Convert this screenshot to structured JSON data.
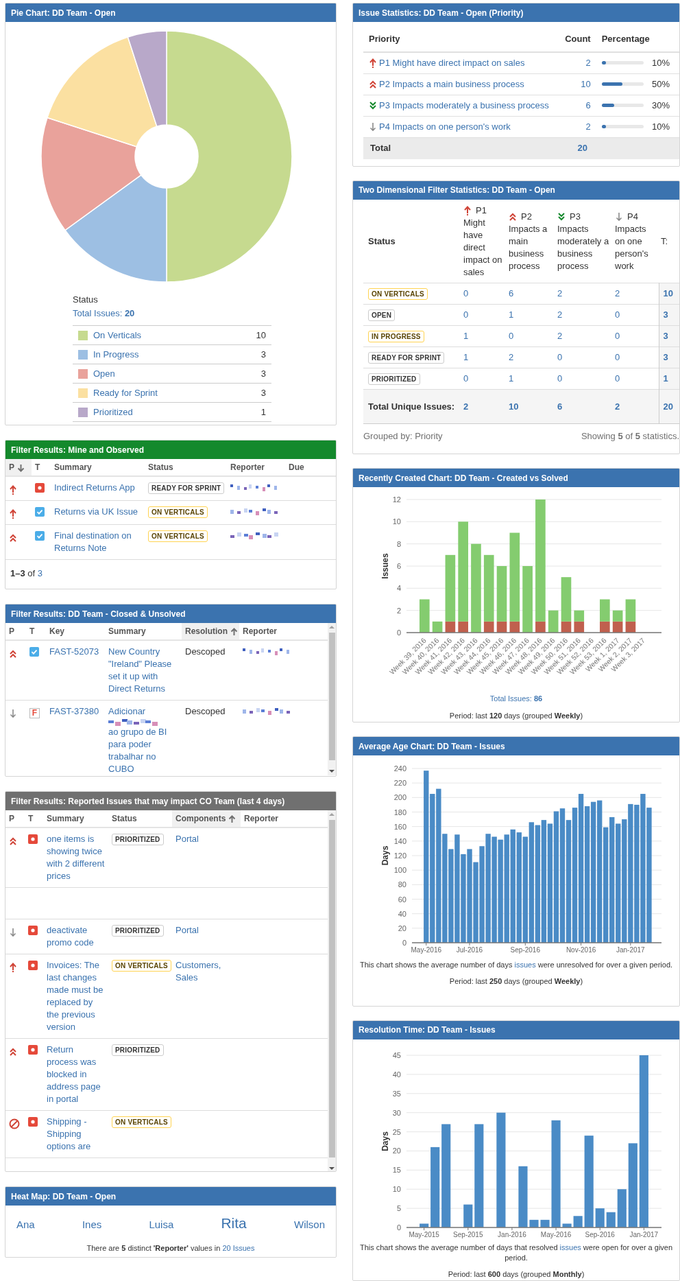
{
  "left_column": [
    {
      "kind": "pie",
      "color": "#3b73af",
      "title": "Pie Chart: DD Team - Open",
      "chart_data": {
        "type": "donut",
        "categories": [
          "On Verticals",
          "In Progress",
          "Open",
          "Ready for Sprint",
          "Prioritized"
        ],
        "values": [
          50,
          15,
          15,
          15,
          5
        ]
      },
      "status_label": "Status",
      "total_label": "Total Issues:",
      "total": "20",
      "legend": [
        {
          "count": "10",
          "color": "#c6da8f"
        },
        {
          "count": "3",
          "color": "#9dbfe3"
        },
        {
          "count": "3",
          "color": "#e9a29b"
        },
        {
          "count": "3",
          "color": "#fbe0a1"
        },
        {
          "count": "1",
          "color": "#b8a8c9"
        }
      ]
    },
    {
      "kind": "filter",
      "color": "#14892c",
      "title": "Filter Results: Mine and Observed",
      "columns": [
        {
          "label": "P",
          "kind": "priority",
          "sorted": true,
          "ascending": false
        },
        {
          "label": "T",
          "kind": "type",
          "sorted": false
        },
        {
          "label": "Summary",
          "kind": "summary",
          "sorted": false
        },
        {
          "label": "Status",
          "kind": "status",
          "sorted": false
        },
        {
          "label": "Reporter",
          "kind": "reporter",
          "sorted": false
        },
        {
          "label": "Due",
          "kind": "due",
          "sorted": false
        }
      ],
      "rows": [
        {
          "priority": {
            "kind": "highest"
          },
          "type": {
            "kind": "bug"
          },
          "summary": "Indirect Returns App",
          "status": {
            "text": "READY FOR SPRINT",
            "kind": "todo"
          },
          "reporter_hidden": true
        },
        {
          "priority": {
            "kind": "highest"
          },
          "type": {
            "kind": "task"
          },
          "summary": "Returns via UK Issue",
          "status": {
            "text": "ON VERTICALS",
            "kind": "inprogress"
          },
          "reporter_hidden": true
        },
        {
          "priority": {
            "kind": "high"
          },
          "type": {
            "kind": "task"
          },
          "summary": "Final destination on Returns Note",
          "status": {
            "text": "ON VERTICALS",
            "kind": "inprogress"
          },
          "reporter_hidden": true
        }
      ],
      "pagination": "**1–3** of",
      "pagination_link": "3"
    },
    {
      "kind": "filter",
      "color": "#3b73af",
      "title": "Filter Results: DD Team - Closed & Unsolved",
      "scrollable": true,
      "columns": [
        {
          "label": "P",
          "kind": "priority",
          "sorted": false
        },
        {
          "label": "T",
          "kind": "type",
          "sorted": false
        },
        {
          "label": "Key",
          "kind": "key",
          "sorted": false
        },
        {
          "label": "Summary",
          "kind": "summary",
          "sorted": false
        },
        {
          "label": "Resolution",
          "kind": "resolution",
          "sorted": true,
          "ascending": true
        },
        {
          "label": "Reporter",
          "kind": "reporter",
          "sorted": false
        }
      ],
      "rows": [
        {
          "priority": {
            "kind": "high"
          },
          "type": {
            "kind": "task"
          },
          "key": "FAST-52073",
          "summary": "New Country \"Ireland\" Please set it up with Direct Returns",
          "resolution": "Descoped",
          "reporter_hidden": true
        },
        {
          "priority": {
            "kind": "lowest"
          },
          "type": {
            "kind": "feature",
            "glyph": "F"
          },
          "key": "FAST-37380",
          "summary": [
            "Adicionar",
            "ao grupo de BI para poder trabalhar no CUBO"
          ],
          "resolution": "Descoped",
          "reporter_hidden": true
        }
      ]
    },
    {
      "kind": "filter",
      "color": "#707070",
      "title": "Filter Results: Reported Issues that may impact CO Team (last 4 days)",
      "scrollable": true,
      "columns": [
        {
          "label": "P",
          "kind": "priority",
          "sorted": false
        },
        {
          "label": "T",
          "kind": "type",
          "sorted": false
        },
        {
          "label": "Summary",
          "kind": "summary",
          "sorted": false
        },
        {
          "label": "Status",
          "kind": "status",
          "sorted": false
        },
        {
          "label": "Components",
          "kind": "components",
          "sorted": true,
          "ascending": true
        },
        {
          "label": "Reporter",
          "kind": "reporter",
          "sorted": false
        }
      ],
      "rows": [
        {
          "kind": "issue",
          "priority": {
            "kind": "high"
          },
          "type": {
            "kind": "bug"
          },
          "summary": "one items is showing twice with 2 different prices",
          "status": {
            "text": "PRIORITIZED",
            "kind": "todo"
          },
          "components": "Portal"
        },
        {
          "kind": "blank"
        },
        {
          "kind": "issue",
          "priority": {
            "kind": "lowest"
          },
          "type": {
            "kind": "bug"
          },
          "summary": "deactivate promo code",
          "status": {
            "text": "PRIORITIZED",
            "kind": "todo"
          },
          "components": "Portal"
        },
        {
          "kind": "issue",
          "priority": {
            "kind": "highest"
          },
          "type": {
            "kind": "bug"
          },
          "summary": "Invoices: The last changes made must be replaced by the previous version",
          "status": {
            "text": "ON VERTICALS",
            "kind": "inprogress"
          },
          "components": "Customers, Sales"
        },
        {
          "kind": "issue",
          "priority": {
            "kind": "high"
          },
          "type": {
            "kind": "bug"
          },
          "summary": "Return process was blocked in address page in portal",
          "status": {
            "text": "PRIORITIZED",
            "kind": "todo"
          }
        },
        {
          "kind": "issue",
          "priority": {
            "kind": "blocker"
          },
          "type": {
            "kind": "bug"
          },
          "summary": "Shipping - Shipping options are",
          "status": {
            "text": "ON VERTICALS",
            "kind": "inprogress"
          }
        }
      ]
    },
    {
      "kind": "heat_map",
      "color": "#3b73af",
      "title": "Heat Map: DD Team - Open",
      "names": [
        {
          "label": "Ana",
          "kind": "medium"
        },
        {
          "label": "Ines",
          "kind": "medium"
        },
        {
          "label": "Luisa",
          "kind": "medium"
        },
        {
          "label": "Rita",
          "kind": "large"
        },
        {
          "label": "Wilson",
          "kind": "medium"
        }
      ],
      "summary": "There are **5** distinct **'Reporter'** values in",
      "summary_link": "20 Issues"
    }
  ],
  "right_column": [
    {
      "kind": "issue_stats",
      "color": "#3b73af",
      "title": "Issue Statistics: DD Team - Open (Priority)",
      "columns": [
        "Priority",
        "Count",
        "Percentage"
      ],
      "rows": [
        {
          "priority": {
            "kind": "highest"
          },
          "label": "P1 Might have direct impact on sales",
          "count": "2",
          "level": 0.1,
          "percentage": "10%"
        },
        {
          "priority": {
            "kind": "high"
          },
          "label": "P2 Impacts a main business process",
          "count": "10",
          "level": 0.5,
          "percentage": "50%"
        },
        {
          "priority": {
            "kind": "low"
          },
          "label": "P3 Impacts moderately a business process",
          "count": "6",
          "level": 0.3,
          "percentage": "30%"
        },
        {
          "priority": {
            "kind": "lowest"
          },
          "label": "P4 Impacts on one person's work",
          "count": "2",
          "level": 0.1,
          "percentage": "10%"
        }
      ],
      "total_label": "Total",
      "total": "20"
    },
    {
      "kind": "two_d",
      "color": "#3b73af",
      "title": "Two Dimensional Filter Statistics: DD Team - Open",
      "status_header": "Status",
      "columns": [
        {
          "priority": {
            "kind": "highest"
          },
          "code": "P1",
          "label": "Might have direct impact on sales"
        },
        {
          "priority": {
            "kind": "high"
          },
          "code": "P2",
          "label": "Impacts a main business process"
        },
        {
          "priority": {
            "kind": "low"
          },
          "code": "P3",
          "label": "Impacts moderately a business process"
        },
        {
          "priority": {
            "kind": "lowest"
          },
          "code": "P4",
          "label": "Impacts on one person's work"
        }
      ],
      "total_header": "T:",
      "rows": [
        {
          "status": {
            "text": "ON VERTICALS",
            "kind": "inprogress"
          },
          "values": [
            "0",
            "6",
            "2",
            "2"
          ],
          "total": "10"
        },
        {
          "status": {
            "text": "OPEN",
            "kind": "todo"
          },
          "values": [
            "0",
            "1",
            "2",
            "0"
          ],
          "total": "3"
        },
        {
          "status": {
            "text": "IN PROGRESS",
            "kind": "inprogress"
          },
          "values": [
            "1",
            "0",
            "2",
            "0"
          ],
          "total": "3"
        },
        {
          "status": {
            "text": "READY FOR SPRINT",
            "kind": "todo"
          },
          "values": [
            "1",
            "2",
            "0",
            "0"
          ],
          "total": "3"
        },
        {
          "status": {
            "text": "PRIORITIZED",
            "kind": "todo"
          },
          "values": [
            "0",
            "1",
            "0",
            "0"
          ],
          "total": "1"
        }
      ],
      "totals_label": "Total Unique Issues:",
      "totals": [
        "2",
        "10",
        "6",
        "2"
      ],
      "grand_total": "20",
      "grouped_by": "Grouped by: Priority",
      "showing": "Showing **5** of **5** statistics."
    },
    {
      "kind": "bar_chart",
      "color": "#3b73af",
      "title": "Recently Created Chart: DD Team - Created vs Solved",
      "chart_data": {
        "type": "bar",
        "ylabel": "Issues",
        "categories": [
          "Week 39, 2016",
          "Week 40, 2016",
          "Week 41, 2016",
          "Week 42, 2016",
          "Week 43, 2016",
          "Week 44, 2016",
          "Week 45, 2016",
          "Week 46, 2016",
          "Week 47, 2016",
          "Week 48, 2016",
          "Week 49, 2016",
          "Week 50, 2016",
          "Week 51, 2016",
          "Week 52, 2016",
          "Week 53, 2016",
          "Week 1, 2017",
          "Week 2, 2017",
          "Week 3, 2017"
        ],
        "series": [
          {
            "color": "#c0604e",
            "values": [
              0,
              0,
              1,
              1,
              0,
              1,
              1,
              1,
              0,
              1,
              0,
              1,
              1,
              0,
              1,
              1,
              1,
              0
            ]
          },
          {
            "color": "#84cc6f",
            "values": [
              3,
              1,
              6,
              9,
              8,
              6,
              5,
              8,
              6,
              11,
              2,
              4,
              1,
              0,
              2,
              1,
              2,
              0
            ]
          }
        ],
        "ylim": [
          0,
          12
        ],
        "yticks": [
          0,
          2,
          4,
          6,
          8,
          10,
          12
        ],
        "stacked": true,
        "grid": true
      },
      "total_label": "Total Issues:",
      "total": "86",
      "period": "Period: last **120** days (grouped **Weekly**)"
    },
    {
      "kind": "bar_chart",
      "color": "#3b73af",
      "title": "Average Age Chart: DD Team - Issues",
      "chart_data": {
        "type": "bar",
        "ylabel": "Days",
        "categories": [
          "May-2016",
          null,
          null,
          null,
          null,
          null,
          null,
          "Jul-2016",
          null,
          null,
          null,
          null,
          null,
          null,
          null,
          null,
          "Sep-2016",
          null,
          null,
          null,
          null,
          null,
          null,
          null,
          null,
          "Nov-2016",
          null,
          null,
          null,
          null,
          null,
          null,
          null,
          "Jan-2017",
          null,
          null,
          null
        ],
        "series": [
          {
            "color": "#4a8bc6",
            "values": [
              237,
              205,
              212,
              150,
              129,
              149,
              122,
              129,
              111,
              133,
              150,
              146,
              142,
              149,
              156,
              152,
              146,
              166,
              162,
              169,
              164,
              181,
              185,
              169,
              186,
              205,
              188,
              194,
              196,
              159,
              173,
              164,
              170,
              191,
              190,
              205,
              186
            ]
          }
        ],
        "ylim": [
          0,
          240
        ],
        "yticks": [
          0,
          20,
          40,
          60,
          80,
          100,
          120,
          140,
          160,
          180,
          200,
          220,
          240
        ],
        "grid": true
      },
      "description": {
        "before": "This chart shows the average number of days",
        "link": "issues",
        "after": "were unresolved for over a given period."
      },
      "period": "Period: last **250** days (grouped **Weekly**)"
    },
    {
      "kind": "bar_chart",
      "color": "#3b73af",
      "title": "Resolution Time: DD Team - Issues",
      "chart_data": {
        "type": "bar",
        "ylabel": "Days",
        "categories": [
          "May-2015",
          null,
          null,
          null,
          "Sep-2015",
          null,
          null,
          null,
          "Jan-2016",
          null,
          null,
          null,
          "May-2016",
          null,
          null,
          null,
          "Sep-2016",
          null,
          null,
          null,
          "Jan-2017"
        ],
        "series": [
          {
            "color": "#4a8bc6",
            "values": [
              1,
              21,
              27,
              null,
              6,
              27,
              null,
              30,
              null,
              16,
              2,
              2,
              28,
              1,
              3,
              24,
              5,
              4,
              10,
              22,
              45
            ]
          }
        ],
        "ylim": [
          0,
          45
        ],
        "yticks": [
          0,
          5,
          10,
          15,
          20,
          25,
          30,
          35,
          40,
          45
        ],
        "grid": true
      },
      "description": {
        "before": "This chart shows the average number of days that resolved",
        "link": "issues",
        "after": "were open for over a given period."
      },
      "period": "Period: last **600** days (grouped **Monthly**)"
    }
  ]
}
